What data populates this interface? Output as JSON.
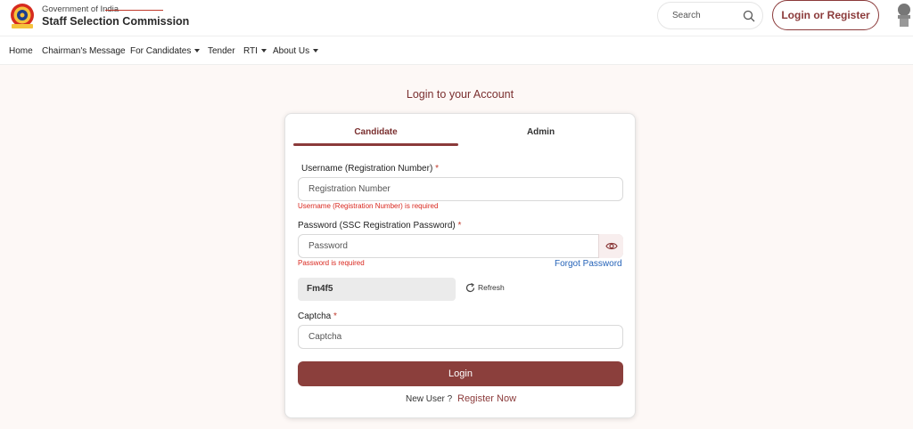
{
  "header": {
    "org_line1": "Government of India",
    "org_line2": "Staff Selection Commission",
    "search_placeholder": "Search",
    "login_register": "Login or Register"
  },
  "nav": {
    "items": [
      {
        "label": "Home",
        "dropdown": false
      },
      {
        "label": "Chairman's Message",
        "dropdown": false
      },
      {
        "label": "For Candidates",
        "dropdown": true
      },
      {
        "label": "Tender",
        "dropdown": false
      },
      {
        "label": "RTI",
        "dropdown": true
      },
      {
        "label": "About Us",
        "dropdown": true
      }
    ]
  },
  "page": {
    "title": "Login to your Account"
  },
  "form": {
    "tabs": [
      "Candidate",
      "Admin"
    ],
    "active_tab": "Candidate",
    "username": {
      "label": "Username (Registration Number)",
      "required_mark": "*",
      "placeholder": "Registration Number",
      "value": "",
      "error": "Username (Registration Number) is required"
    },
    "password": {
      "label": "Password (SSC Registration Password)",
      "required_mark": "*",
      "placeholder": "Password",
      "value": "",
      "error": "Password is required"
    },
    "forgot_password": "Forgot Password",
    "captcha_code": "Fm4f5",
    "refresh_label": "Refresh",
    "captcha": {
      "label": "Captcha",
      "required_mark": "*",
      "placeholder": "Captcha",
      "value": ""
    },
    "login_button": "Login",
    "new_user_text": "New User ?",
    "register_link": "Register Now"
  },
  "colors": {
    "brand": "#8b3a3a",
    "error": "#d9281f",
    "link": "#2563b8",
    "background": "#fdf8f6"
  },
  "icons": [
    "ssc-logo",
    "search-icon",
    "national-emblem",
    "eye-icon",
    "refresh-icon",
    "caret-down-icon"
  ]
}
